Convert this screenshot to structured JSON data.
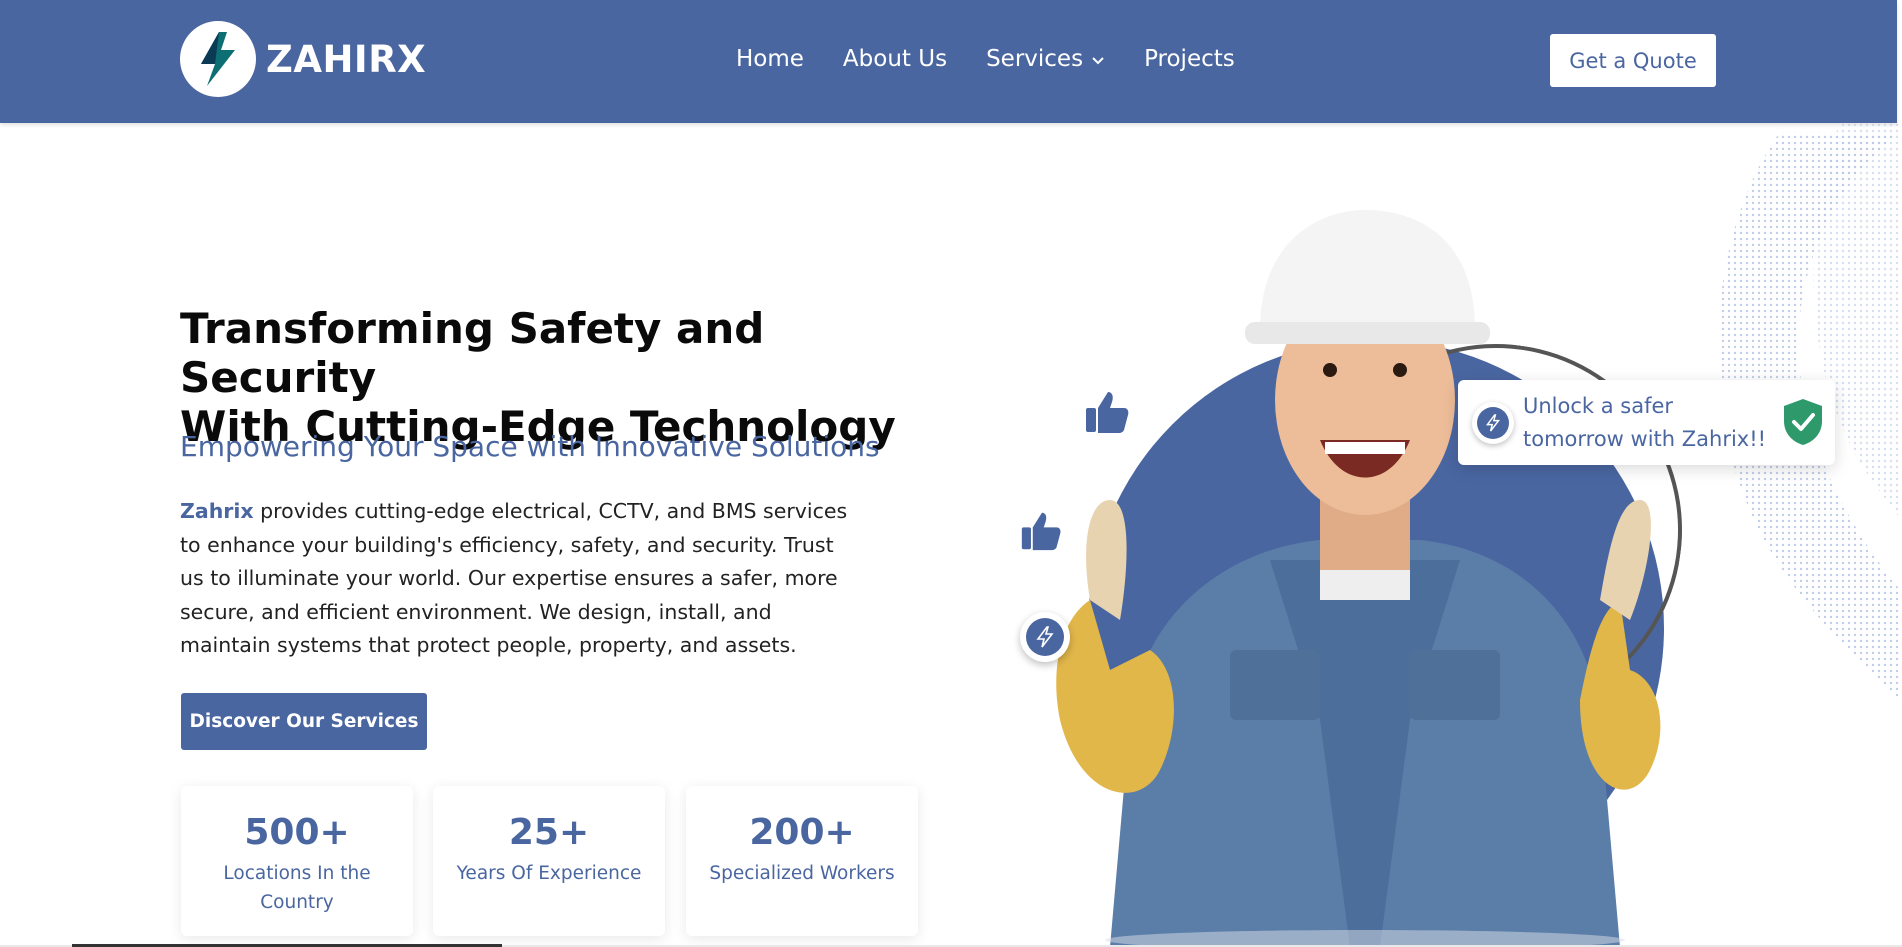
{
  "brand": {
    "name": "ZAHIRX"
  },
  "nav": {
    "items": [
      {
        "label": "Home"
      },
      {
        "label": "About Us"
      },
      {
        "label": "Services"
      },
      {
        "label": "Projects"
      }
    ],
    "cta": "Get a Quote"
  },
  "hero": {
    "title_line1": "Transforming Safety and Security",
    "title_line2": "With Cutting-Edge Technology",
    "subtitle": "Empowering Your Space with Innovative Solutions",
    "desc_brand": "Zahrix",
    "desc_rest": " provides cutting-edge electrical, CCTV, and BMS services to enhance your building's efficiency, safety, and security. Trust us to illuminate your world. Our expertise ensures a safer, more secure, and efficient environment. We design, install, and maintain systems that protect people, property, and assets.",
    "button": "Discover Our Services"
  },
  "stats": [
    {
      "value": "500+",
      "label": "Locations In the Country"
    },
    {
      "value": "25+",
      "label": "Years Of Experience"
    },
    {
      "value": "200+",
      "label": "Specialized Workers"
    }
  ],
  "callout": {
    "text": "Unlock a safer tomorrow with Zahrix!!"
  },
  "colors": {
    "brand": "#4a66a1",
    "shield": "#2e9a6b",
    "logo_teal": "#0d6e73"
  },
  "icons": [
    "lightning-bolt-icon",
    "chevron-down-icon",
    "thumbs-up-icon",
    "shield-check-icon"
  ]
}
